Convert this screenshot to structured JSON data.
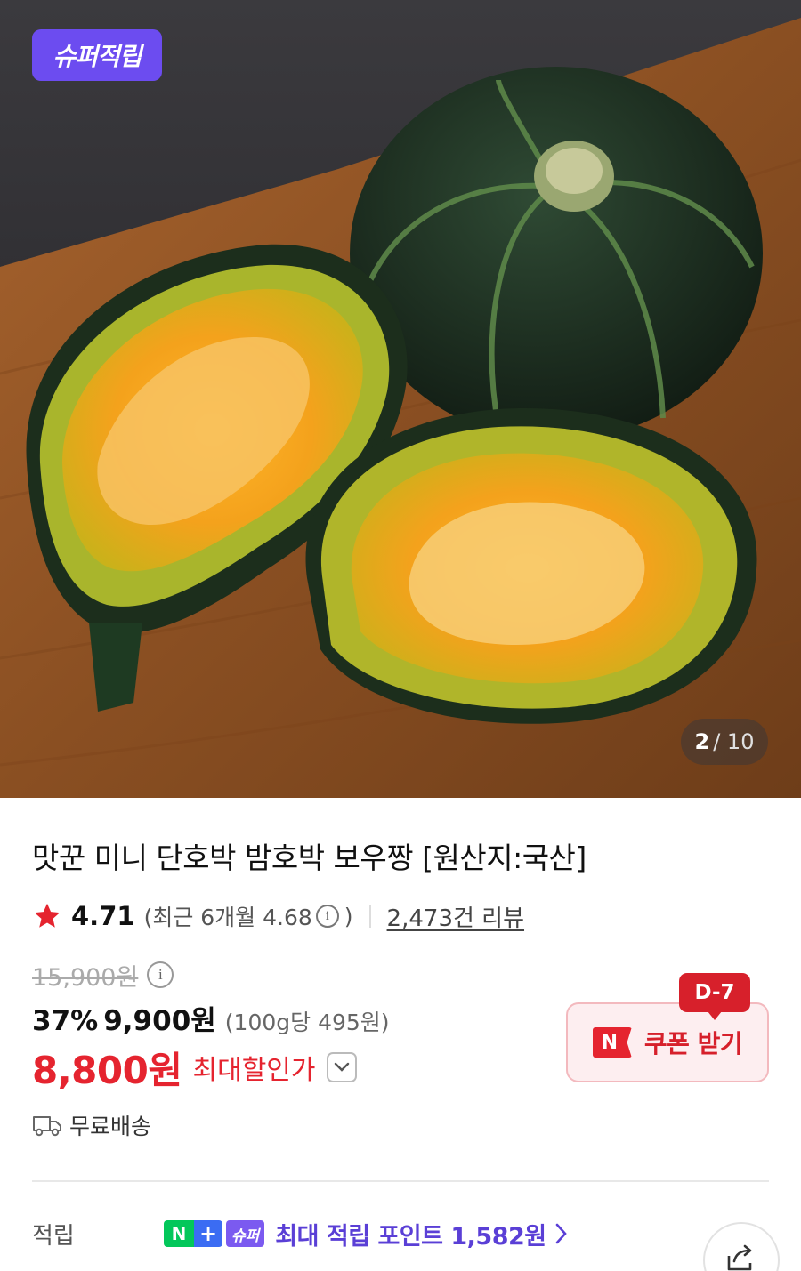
{
  "image": {
    "badge": "슈퍼적립",
    "counter_current": "2",
    "counter_total": "/ 10"
  },
  "product": {
    "title": "맛꾼 미니 단호박 밤호박 보우짱 [원산지:국산]",
    "rating": "4.71",
    "recent_rating": "(최근 6개월 4.68",
    "recent_close": ")",
    "info_glyph": "i",
    "reviews": "2,473건 리뷰",
    "original_price": "15,900원",
    "discount_percent": "37%",
    "discount_price": "9,900원",
    "unit_price": "(100g당 495원)",
    "final_price": "8,800원",
    "max_discount_label": "최대할인가",
    "shipping": "무료배송"
  },
  "coupon": {
    "dday": "D-7",
    "icon_letter": "N",
    "label": "쿠폰 받기"
  },
  "points": {
    "label": "적립",
    "np_n": "N",
    "np_plus": "+",
    "super_label": "슈퍼",
    "text": "최대 적립 포인트 1,582원"
  },
  "colors": {
    "accent_red": "#e5242f",
    "super_purple": "#6c4cf0",
    "naver_green": "#03c75a"
  }
}
